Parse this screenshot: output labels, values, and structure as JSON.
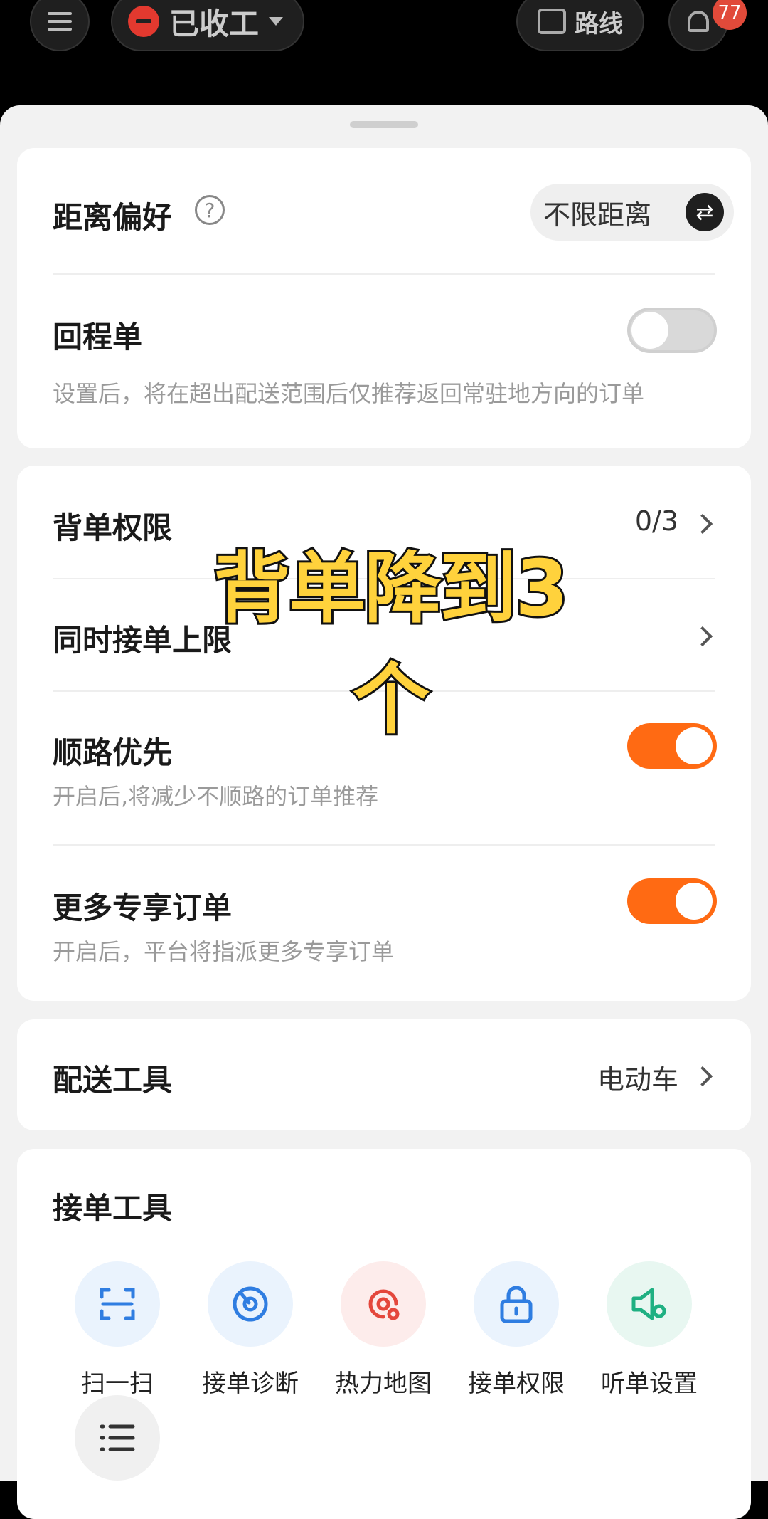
{
  "topbar": {
    "status_label": "已收工",
    "route_label": "路线",
    "notification_count": "77"
  },
  "distance": {
    "title": "距离偏好",
    "help_icon": "?",
    "value": "不限距离",
    "swap_icon": "⇄"
  },
  "return_trip": {
    "title": "回程单",
    "enabled": false,
    "description": "设置后，将在超出配送范围后仅推荐返回常驻地方向的订单"
  },
  "backlog": {
    "title": "背单权限",
    "value": "0/3"
  },
  "concurrent": {
    "title": "同时接单上限"
  },
  "along_route": {
    "title": "顺路优先",
    "enabled": true,
    "description": "开启后,将减少不顺路的订单推荐"
  },
  "exclusive": {
    "title": "更多专享订单",
    "enabled": true,
    "description": "开启后，平台将指派更多专享订单"
  },
  "delivery_tool": {
    "title": "配送工具",
    "value": "电动车"
  },
  "order_tools": {
    "title": "接单工具",
    "items": [
      {
        "label": "扫一扫",
        "icon": "scan-icon",
        "color": "#2f7de1",
        "bg": "#eaf3fd"
      },
      {
        "label": "接单诊断",
        "icon": "diagnosis-icon",
        "color": "#2f7de1",
        "bg": "#eaf3fd"
      },
      {
        "label": "热力地图",
        "icon": "heatmap-icon",
        "color": "#e4473c",
        "bg": "#fdeceb"
      },
      {
        "label": "接单权限",
        "icon": "lock-icon",
        "color": "#2f7de1",
        "bg": "#eaf3fd"
      },
      {
        "label": "听单设置",
        "icon": "speaker-settings-icon",
        "color": "#1fb082",
        "bg": "#e8f7f1"
      }
    ],
    "more_icon": "list-icon"
  },
  "overlay_caption": "背单降到3个",
  "colors": {
    "accent": "#ff6a13",
    "caption": "#ffd23c"
  }
}
